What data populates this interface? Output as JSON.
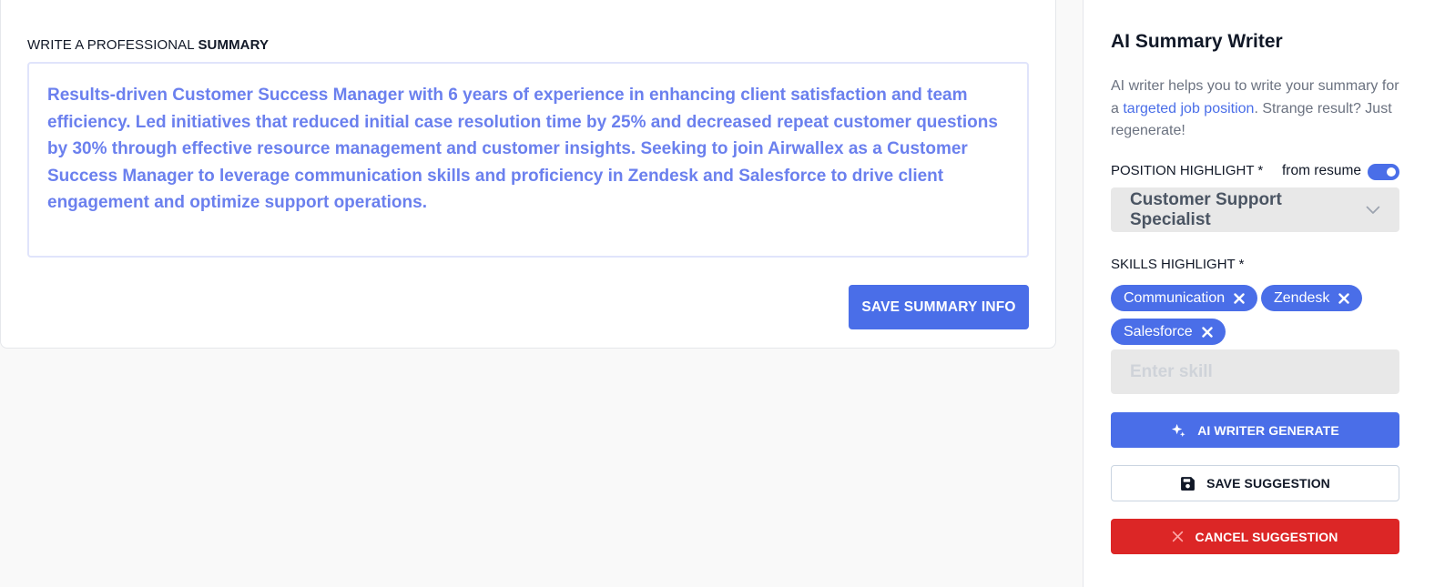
{
  "summary": {
    "heading_prefix": "WRITE A PROFESSIONAL",
    "heading_bold": "SUMMARY",
    "text": "Results-driven Customer Success Manager with 6 years of experience in enhancing client satisfaction and team efficiency. Led initiatives that reduced initial case resolution time by 25% and decreased repeat customer questions by 30% through effective resource management and customer insights. Seeking to join Airwallex as a Customer Success Manager to leverage communication skills and proficiency in Zendesk and Salesforce to drive client engagement and optimize support operations.",
    "save_label": "SAVE SUMMARY INFO"
  },
  "ai_panel": {
    "title": "AI Summary Writer",
    "desc_before": "AI writer helps you to write your summary for a ",
    "desc_link": "targeted job position",
    "desc_after": ". Strange result? Just regenerate!",
    "position_label": "POSITION HIGHLIGHT",
    "required_mark": "*",
    "from_resume_label": "from resume",
    "from_resume_on": true,
    "position_value": "Customer Support Specialist",
    "skills_label": "SKILLS HIGHLIGHT",
    "skills": [
      "Communication",
      "Zendesk",
      "Salesforce"
    ],
    "skill_placeholder": "Enter skill",
    "generate_label": "AI WRITER GENERATE",
    "save_suggestion_label": "SAVE SUGGESTION",
    "cancel_suggestion_label": "CANCEL SUGGESTION"
  },
  "icons": {
    "generate": "sparkle-icon",
    "save": "floppy-disk-icon",
    "cancel": "close-icon",
    "select": "chevron-down-icon",
    "chip_remove": "close-icon"
  },
  "colors": {
    "accent": "#4a6ee8",
    "summary_text": "#6b80ee",
    "danger": "#dc2626",
    "input_bg": "#e8e8e8"
  }
}
